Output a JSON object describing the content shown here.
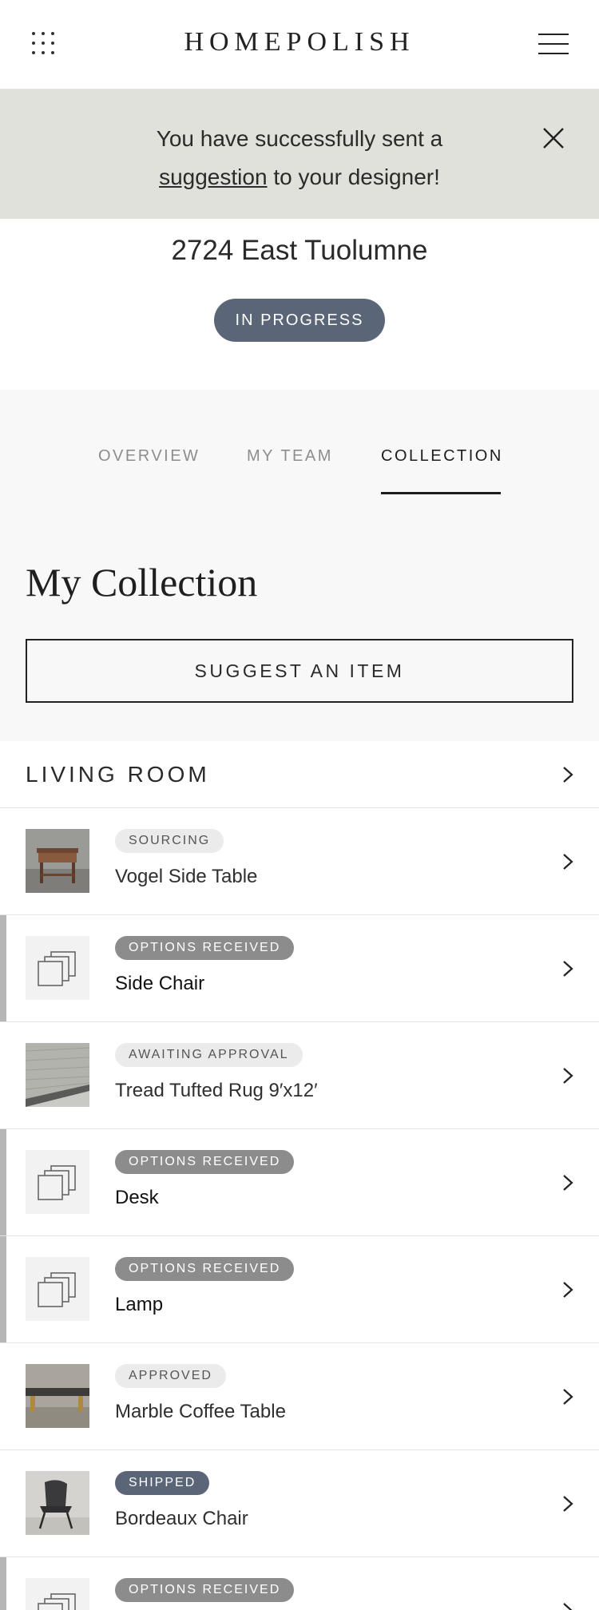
{
  "header": {
    "logo": "HOMEPOLISH",
    "apps_icon": "grid-dots-icon",
    "menu_icon": "hamburger-menu-icon"
  },
  "banner": {
    "text_before": "You have successfully sent a",
    "link_text": "suggestion",
    "text_after": "to your designer!",
    "close_icon": "close-icon"
  },
  "project": {
    "title": "2724 East Tuolumne",
    "status": "IN PROGRESS"
  },
  "tabs": [
    {
      "label": "OVERVIEW",
      "active": false
    },
    {
      "label": "MY TEAM",
      "active": false
    },
    {
      "label": "COLLECTION",
      "active": true
    }
  ],
  "collection": {
    "title": "My Collection",
    "suggest_button": "SUGGEST AN ITEM"
  },
  "room": {
    "label": "LIVING ROOM"
  },
  "items": [
    {
      "badge": "SOURCING",
      "name": "Vogel Side Table",
      "thumb": "side-table-photo"
    },
    {
      "badge": "OPTIONS RECEIVED",
      "name": "Side Chair",
      "thumb": "stacked-squares-icon"
    },
    {
      "badge": "AWAITING APPROVAL",
      "name": "Tread Tufted Rug 9′x12′",
      "thumb": "rug-photo"
    },
    {
      "badge": "OPTIONS RECEIVED",
      "name": "Desk",
      "thumb": "stacked-squares-icon"
    },
    {
      "badge": "OPTIONS RECEIVED",
      "name": "Lamp",
      "thumb": "stacked-squares-icon"
    },
    {
      "badge": "APPROVED",
      "name": "Marble Coffee Table",
      "thumb": "coffee-table-photo"
    },
    {
      "badge": "SHIPPED",
      "name": "Bordeaux Chair",
      "thumb": "chair-photo"
    },
    {
      "badge": "OPTIONS RECEIVED",
      "name": "",
      "thumb": "stacked-squares-icon"
    }
  ],
  "colors": {
    "banner_bg": "#dfe1da",
    "status_pill": "#5a6578",
    "badge_options": "#8c8c8c",
    "badge_light": "#ebebeb",
    "flag_bar": "#b6b6b6"
  }
}
